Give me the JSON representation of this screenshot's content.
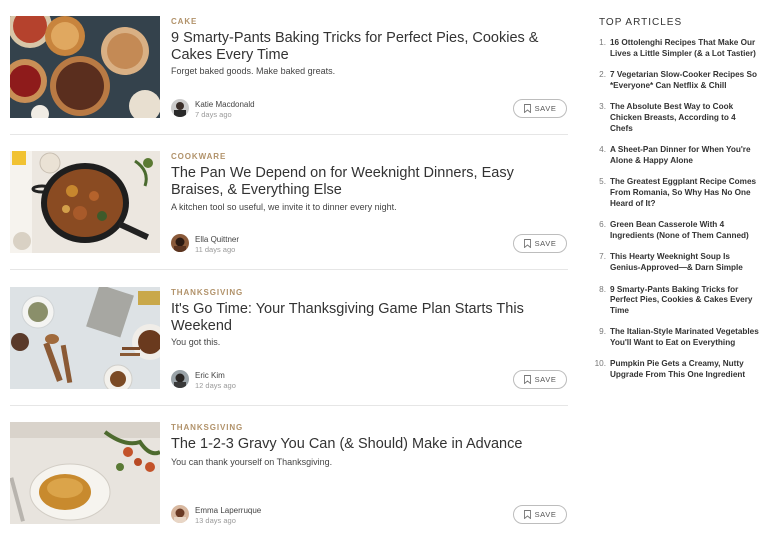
{
  "articles": [
    {
      "tag": "CAKE",
      "title": "9 Smarty-Pants Baking Tricks for Perfect Pies, Cookies & Cakes Every Time",
      "dek": "Forget baked goods. Make baked greats.",
      "author": "Katie Macdonald",
      "date": "7 days ago",
      "save_label": "SAVE",
      "thumb": "pies",
      "colors": {
        "bg": "#2e3b45",
        "accent": "#c77a3a"
      }
    },
    {
      "tag": "COOKWARE",
      "title": "The Pan We Depend on for Weeknight Dinners, Easy Braises, & Everything Else",
      "dek": "A kitchen tool so useful, we invite it to dinner every night.",
      "author": "Ella Quittner",
      "date": "11 days ago",
      "save_label": "SAVE",
      "thumb": "pan",
      "colors": {
        "bg": "#ebe6df",
        "accent": "#9a5a2e"
      }
    },
    {
      "tag": "THANKSGIVING",
      "title": "It's Go Time: Your Thanksgiving Game Plan Starts This Weekend",
      "dek": "You got this.",
      "author": "Eric Kim",
      "date": "12 days ago",
      "save_label": "SAVE",
      "thumb": "spices",
      "colors": {
        "bg": "#dfe3e6",
        "accent": "#8a5a3c"
      }
    },
    {
      "tag": "THANKSGIVING",
      "title": "The 1-2-3 Gravy You Can (& Should) Make in Advance",
      "dek": "You can thank yourself on Thanksgiving.",
      "author": "Emma Laperruque",
      "date": "13 days ago",
      "save_label": "SAVE",
      "thumb": "gravy",
      "colors": {
        "bg": "#e9e5df",
        "accent": "#c98a2a"
      }
    }
  ],
  "sidebar": {
    "title": "TOP ARTICLES",
    "items": [
      {
        "num": "1.",
        "text": "16 Ottolenghi Recipes That Make Our Lives a Little Simpler (& a Lot Tastier)"
      },
      {
        "num": "2.",
        "text": "7 Vegetarian Slow-Cooker Recipes So *Everyone* Can Netflix & Chill"
      },
      {
        "num": "3.",
        "text": "The Absolute Best Way to Cook Chicken Breasts, According to 4 Chefs"
      },
      {
        "num": "4.",
        "text": "A Sheet-Pan Dinner for When You're Alone & Happy Alone"
      },
      {
        "num": "5.",
        "text": "The Greatest Eggplant Recipe Comes From Romania, So Why Has No One Heard of It?"
      },
      {
        "num": "6.",
        "text": "Green Bean Casserole With 4 Ingredients (None of Them Canned)"
      },
      {
        "num": "7.",
        "text": "This Hearty Weeknight Soup Is Genius-Approved—& Darn Simple"
      },
      {
        "num": "8.",
        "text": "9 Smarty-Pants Baking Tricks for Perfect Pies, Cookies & Cakes Every Time"
      },
      {
        "num": "9.",
        "text": "The Italian-Style Marinated Vegetables You'll Want to Eat on Everything"
      },
      {
        "num": "10.",
        "text": "Pumpkin Pie Gets a Creamy, Nutty Upgrade From This One Ingredient"
      }
    ]
  },
  "colors": {
    "tag": "#b1926a",
    "text": "#333333",
    "muted": "#9a9a9a",
    "border": "#bdbdbd"
  }
}
